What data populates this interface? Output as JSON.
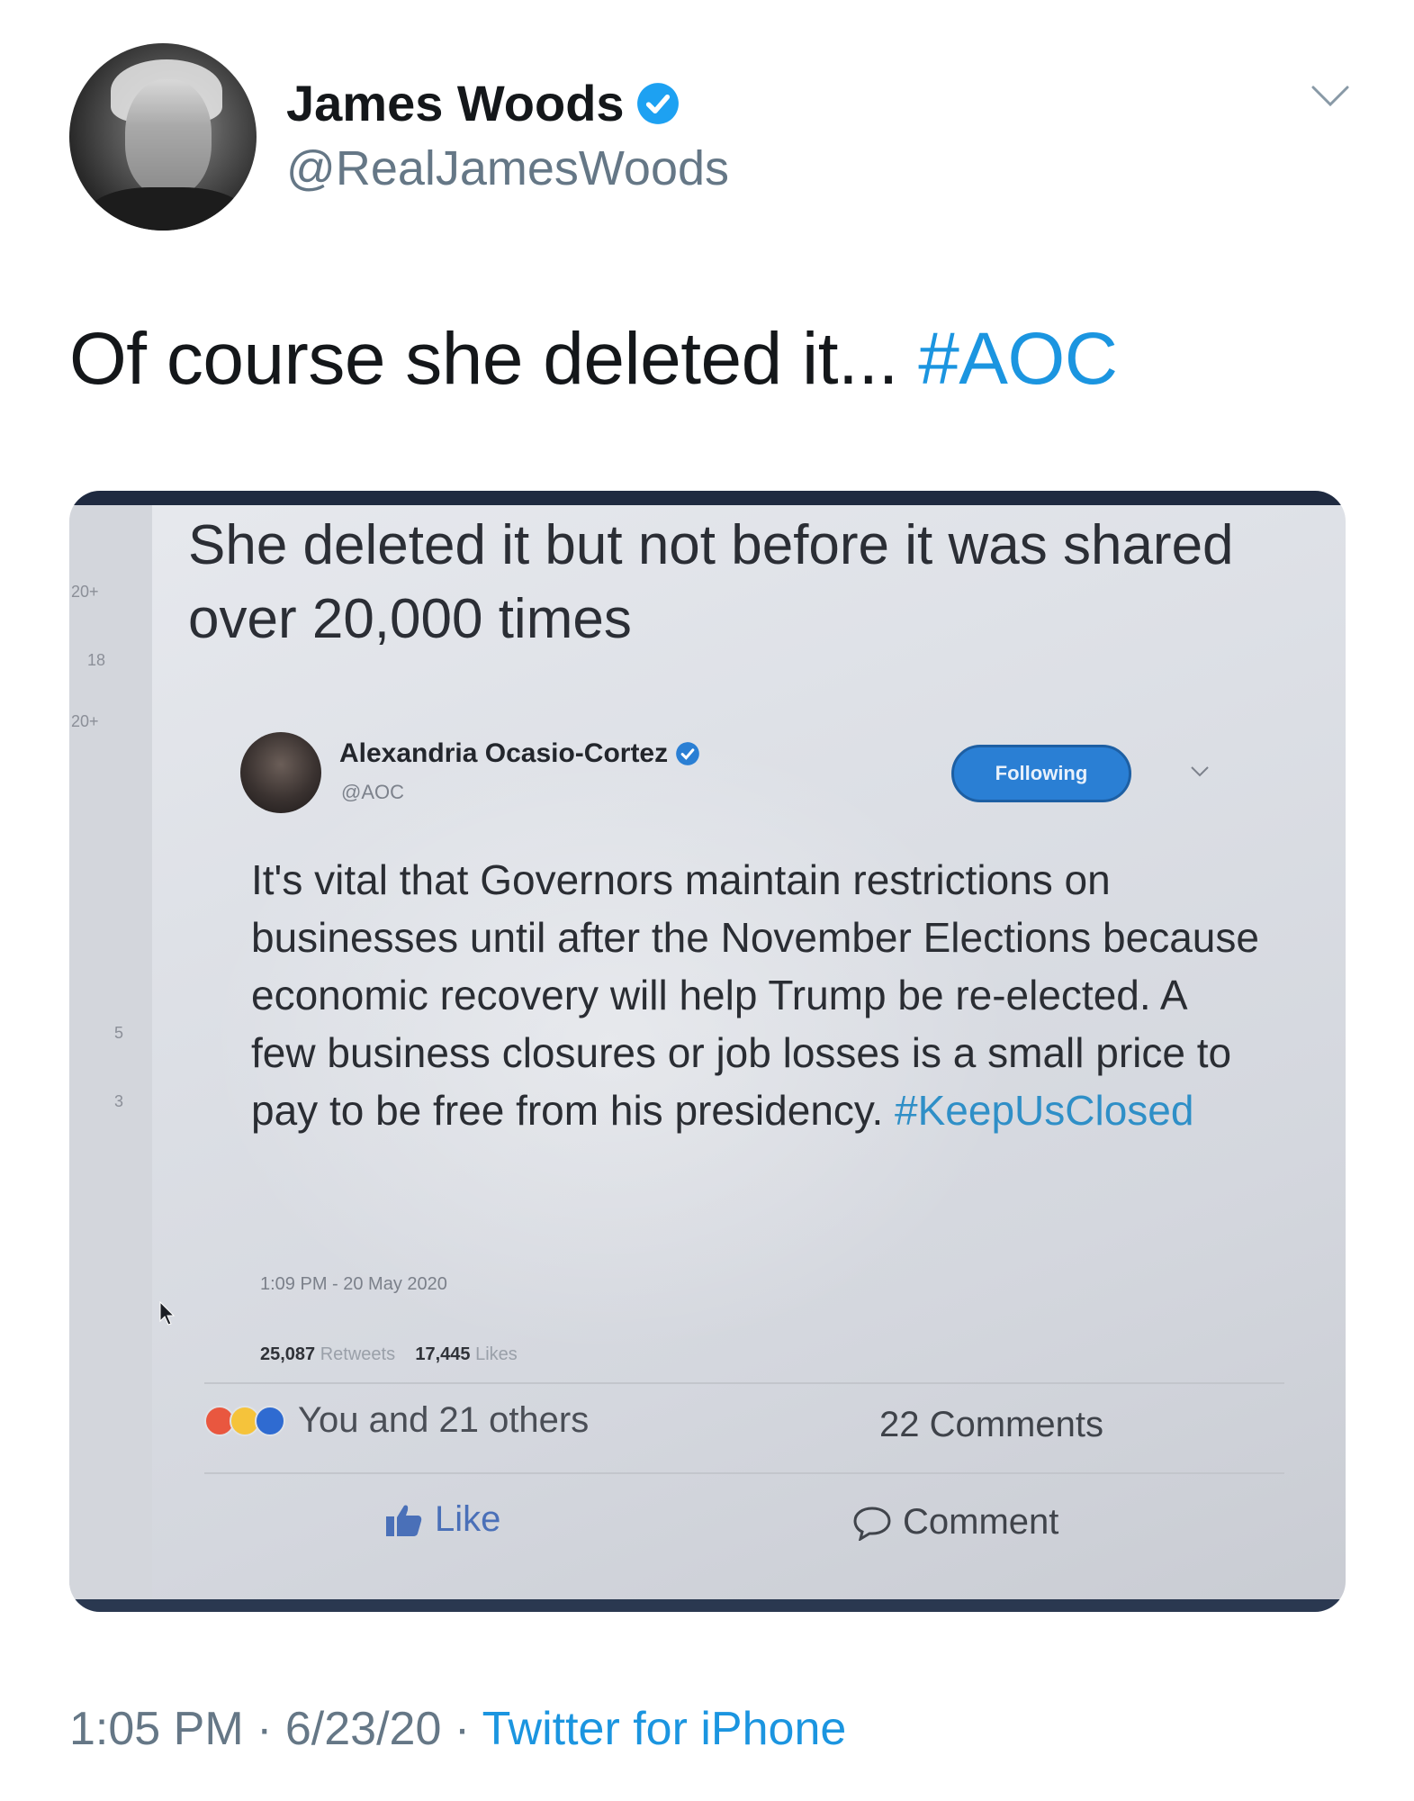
{
  "tweet": {
    "display_name": "James Woods",
    "handle": "@RealJamesWoods",
    "text_main": "Of course she deleted it... ",
    "hashtag": "#AOC",
    "time": "1:05 PM",
    "date": "6/23/20",
    "separator": " · ",
    "source": "Twitter for iPhone",
    "accent_color": "#1b95e0"
  },
  "photo": {
    "caption": "She deleted it but not before it was shared over 20,000 times",
    "gutter_numbers": [
      "20+",
      "18",
      "20+",
      "5",
      "3"
    ],
    "embedded_tweet": {
      "name": "Alexandria Ocasio-Cortez",
      "handle": "@AOC",
      "follow_label": "Following",
      "text": "It's vital that Governors maintain restrictions on businesses until after the November Elections because economic recovery will help Trump be re-elected. A few business closures or job losses is a small price to pay to be free from his presidency. ",
      "hashtag": "#KeepUsClosed",
      "timestamp": "1:09 PM - 20 May 2020",
      "retweets_count": "25,087",
      "retweets_label": "Retweets",
      "likes_count": "17,445",
      "likes_label": "Likes"
    },
    "facebook": {
      "reactions_text": "You and 21 others",
      "comments_count": "22 Comments",
      "like_label": "Like",
      "comment_label": "Comment"
    }
  }
}
